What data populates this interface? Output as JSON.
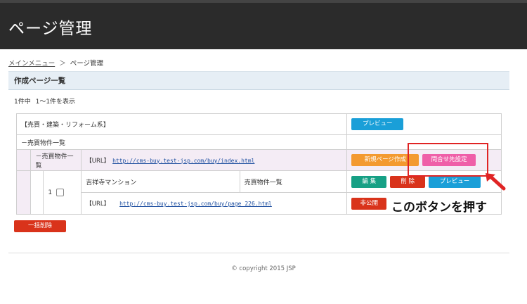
{
  "header": {
    "title": "ページ管理"
  },
  "breadcrumb": {
    "home": "メインメニュー",
    "separator": "＞",
    "current": "ページ管理"
  },
  "section": {
    "title": "作成ページ一覧"
  },
  "count": {
    "total": "1件中",
    "range": "1〜1件を表示"
  },
  "tree": {
    "category": {
      "label": "【売買・建築・リフォーム系】",
      "preview_label": "プレビュー"
    },
    "group": {
      "label": "－売買物件一覧"
    },
    "subgroup": {
      "label": "－売買物件一覧",
      "url_tag": "【URL】",
      "url": "http://cms-buy.test-jsp.com/buy/index.html",
      "new_page_label": "新規ページ作成",
      "contact_label": "問合せ先設定"
    },
    "page": {
      "number": "1",
      "name": "吉祥寺マンション",
      "type": "売買物件一覧",
      "edit_label": "編 集",
      "delete_label": "削 除",
      "preview_label": "プレビュー",
      "url_tag": "【URL】",
      "url": "http://cms-buy.test-jsp.com/buy/page_226.html",
      "private_label": "非公開"
    }
  },
  "bulk_delete_label": "一括削除",
  "footer": {
    "copyright": "© copyright 2015 JSP"
  },
  "annotation": {
    "text": "このボタンを押す"
  },
  "colors": {
    "header_bg": "#2b2b2b",
    "preview": "#1a9fd8",
    "new_page": "#f39a30",
    "contact": "#ef5fa8",
    "edit": "#16a085",
    "delete": "#d9331b",
    "highlight": "#e02424"
  }
}
